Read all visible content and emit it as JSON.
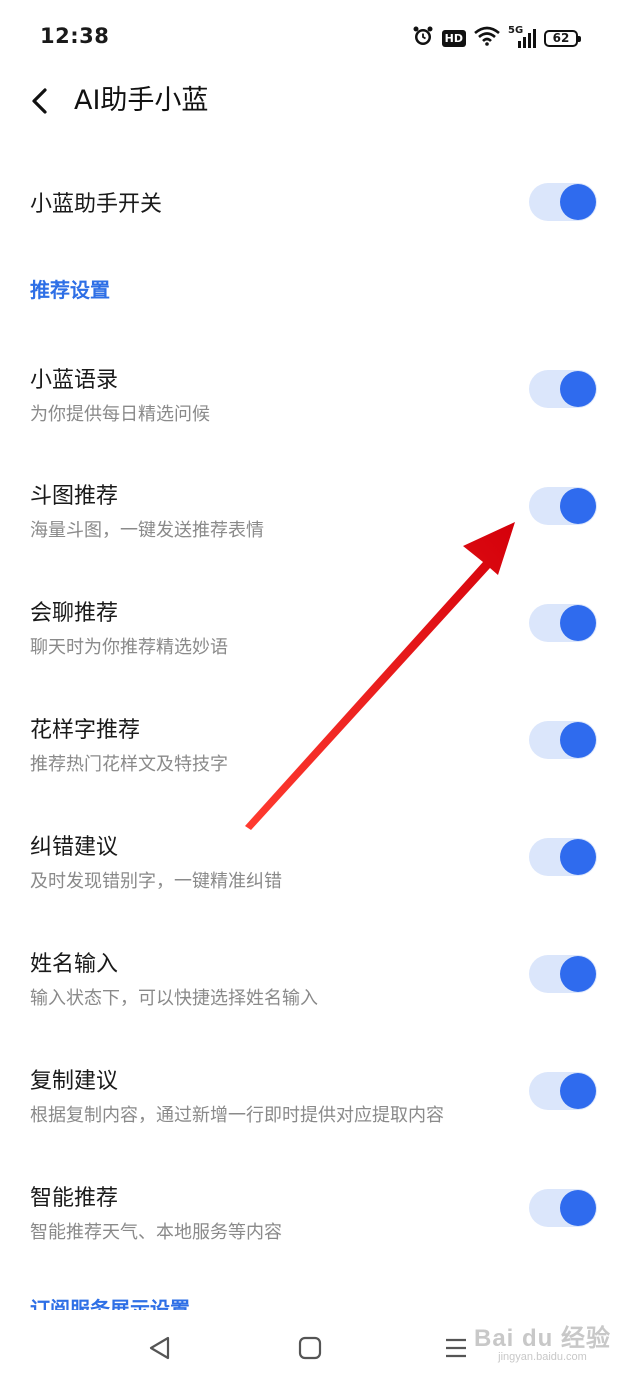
{
  "status_bar": {
    "time": "12:38",
    "hd": "HD",
    "signal": "5G",
    "battery": "62",
    "icons": [
      "alarm-icon",
      "wifi-icon",
      "signal-icon",
      "battery-icon"
    ]
  },
  "header": {
    "back_icon": "chevron-left-icon",
    "title": "AI助手小蓝"
  },
  "master_switch": {
    "label": "小蓝助手开关",
    "enabled": true
  },
  "recommend_section": {
    "title": "推荐设置",
    "items": [
      {
        "title": "小蓝语录",
        "subtitle": "为你提供每日精选问候",
        "enabled": true
      },
      {
        "title": "斗图推荐",
        "subtitle": "海量斗图，一键发送推荐表情",
        "enabled": true
      },
      {
        "title": "会聊推荐",
        "subtitle": "聊天时为你推荐精选妙语",
        "enabled": true
      },
      {
        "title": "花样字推荐",
        "subtitle": "推荐热门花样文及特技字",
        "enabled": true
      },
      {
        "title": "纠错建议",
        "subtitle": "及时发现错别字，一键精准纠错",
        "enabled": true
      },
      {
        "title": "姓名输入",
        "subtitle": "输入状态下，可以快捷选择姓名输入",
        "enabled": true
      },
      {
        "title": "复制建议",
        "subtitle": "根据复制内容，通过新增一行即时提供对应提取内容",
        "enabled": true
      },
      {
        "title": "智能推荐",
        "subtitle": "智能推荐天气、本地服务等内容",
        "enabled": true
      }
    ]
  },
  "next_section": {
    "title": "订阅服务展示设置"
  },
  "nav_bar": {
    "icons": [
      "back-triangle-icon",
      "home-square-icon",
      "menu-lines-icon"
    ]
  },
  "watermark": {
    "main": "Bai du 经验",
    "sub": "jingyan.baidu.com"
  },
  "colors": {
    "accent": "#2f6bee",
    "toggle_track": "#dbe6fb",
    "section_text": "#2e6fe6",
    "annotation_arrow": "#e8131b"
  }
}
